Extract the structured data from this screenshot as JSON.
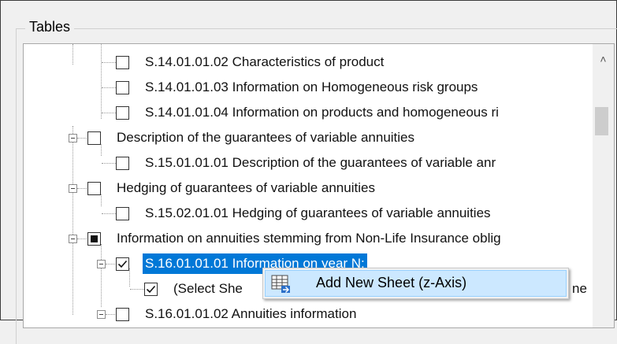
{
  "groupbox": {
    "title": "Tables"
  },
  "tree": {
    "rows": [
      {
        "label": "S.14.01.01.02 Characteristics of product",
        "check": "unchecked"
      },
      {
        "label": "S.14.01.01.03 Information on Homogeneous risk groups",
        "check": "unchecked"
      },
      {
        "label": "S.14.01.01.04 Information on products and homogeneous ri",
        "check": "unchecked"
      },
      {
        "label": "Description of the guarantees of variable annuities",
        "check": "unchecked",
        "expanded": true
      },
      {
        "label": "S.15.01.01.01 Description of the guarantees of variable anr",
        "check": "unchecked"
      },
      {
        "label": "Hedging of guarantees of variable annuities",
        "check": "unchecked",
        "expanded": true
      },
      {
        "label": "S.15.02.01.01 Hedging of guarantees of variable annuities",
        "check": "unchecked"
      },
      {
        "label": "Information on annuities stemming from Non-Life Insurance oblig",
        "check": "partial",
        "expanded": true
      },
      {
        "label": "S.16.01.01.01 Information on year N:",
        "check": "checked",
        "expanded": true,
        "selected": true
      },
      {
        "label": "(Select She",
        "trailing_text": "ne",
        "check": "checked"
      },
      {
        "label": "S.16.01.01.02 Annuities information",
        "check": "unchecked",
        "expanded": true
      }
    ]
  },
  "context_menu": {
    "items": [
      {
        "label": "Add New Sheet (z-Axis)",
        "icon": "add-sheet-icon"
      }
    ]
  },
  "colors": {
    "selection": "#0078d7",
    "menu_highlight": "#cce8ff"
  }
}
